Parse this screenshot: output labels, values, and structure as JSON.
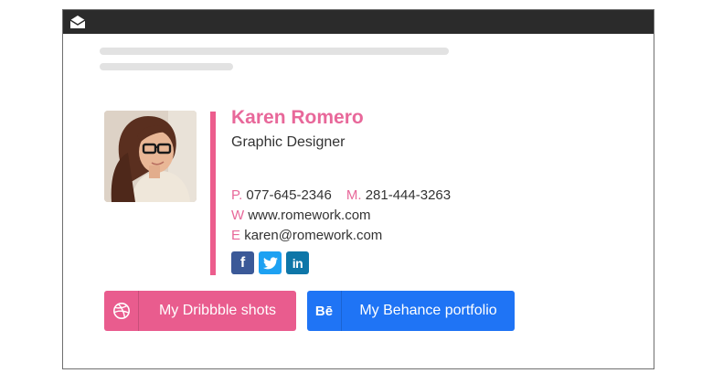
{
  "signature": {
    "name": "Karen Romero",
    "title": "Graphic Designer",
    "phone_label": "P.",
    "phone": "077-645-2346",
    "mobile_label": "M.",
    "mobile": "281-444-3263",
    "web_label": "W",
    "website": "www.romework.com",
    "email_label": "E",
    "email": "karen@romework.com"
  },
  "social": {
    "facebook_glyph": "f",
    "linkedin_glyph": "in"
  },
  "buttons": {
    "dribbble_label": "My Dribbble shots",
    "behance_label": "My Behance portfolio",
    "behance_glyph": "Bē"
  },
  "colors": {
    "accent_pink": "#e8689a",
    "titlebar": "#2b2b2b",
    "facebook": "#3b5998",
    "twitter": "#1da1f2",
    "linkedin": "#0e76a8",
    "behance_blue": "#1f74f5"
  },
  "icons": [
    "envelope-icon",
    "facebook-icon",
    "twitter-icon",
    "linkedin-icon",
    "dribbble-icon",
    "behance-icon"
  ]
}
